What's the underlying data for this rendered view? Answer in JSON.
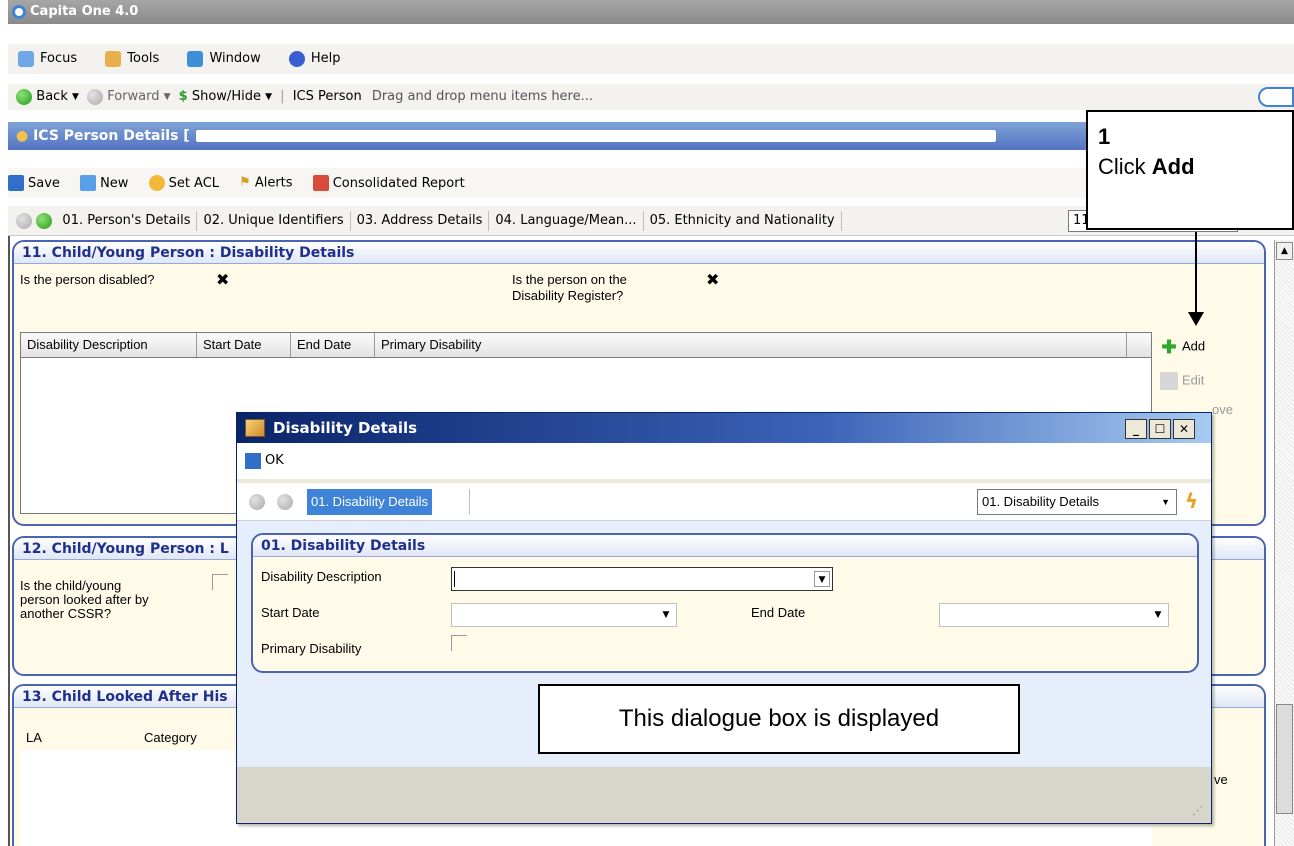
{
  "window": {
    "title": "Capita One 4.0"
  },
  "menu": [
    {
      "label": "Focus",
      "icon": "focus-icon"
    },
    {
      "label": "Tools",
      "icon": "tools-icon"
    },
    {
      "label": "Window",
      "icon": "window-icon"
    },
    {
      "label": "Help",
      "icon": "help-icon"
    }
  ],
  "nav": {
    "back": "Back",
    "forward": "Forward",
    "showhide": "Show/Hide",
    "ics_person": "ICS Person",
    "drag_hint": "Drag and drop menu items here..."
  },
  "person_header": {
    "title": "ICS Person Details ["
  },
  "actions": {
    "save": "Save",
    "new": "New",
    "set_acl": "Set ACL",
    "alerts": "Alerts",
    "consolidated": "Consolidated Report"
  },
  "tabs": [
    "01. Person's Details",
    "02. Unique Identifiers",
    "03. Address Details",
    "04. Language/Mean...",
    "05. Ethnicity and Nationality"
  ],
  "tab_combo": "11",
  "panel11": {
    "title": "11. Child/Young Person : Disability Details",
    "q_disabled": "Is the person disabled?",
    "q_register_1": "Is the person on the",
    "q_register_2": "Disability Register?",
    "mark": "✖",
    "columns": [
      "Disability Description",
      "Start Date",
      "End Date",
      "Primary Disability"
    ],
    "add": "Add",
    "edit": "Edit",
    "remove_partial": "ove"
  },
  "panel12": {
    "title": "12. Child/Young Person : L",
    "q1": "Is the child/young",
    "q2": "person looked after by",
    "q3": "another CSSR?"
  },
  "panel13": {
    "title": "13. Child Looked After His",
    "col_la": "LA",
    "col_category": "Category",
    "partial": "ve"
  },
  "dialog": {
    "title": "Disability Details",
    "ok": "OK",
    "tab": "01. Disability Details",
    "combo": "01. Disability Details",
    "panel_title": "01. Disability Details",
    "lbl_desc": "Disability Description",
    "lbl_start": "Start Date",
    "lbl_end": "End Date",
    "lbl_primary": "Primary Disability"
  },
  "callouts": {
    "step": "1",
    "click": "Click ",
    "click_bold": "Add",
    "dialog_msg": "This dialogue box is displayed"
  },
  "colors": {
    "panel_border": "#4a63b3",
    "panel_bg": "#fffbe8",
    "header_blue": "#5473c2",
    "tab_selected": "#3f83d8"
  }
}
